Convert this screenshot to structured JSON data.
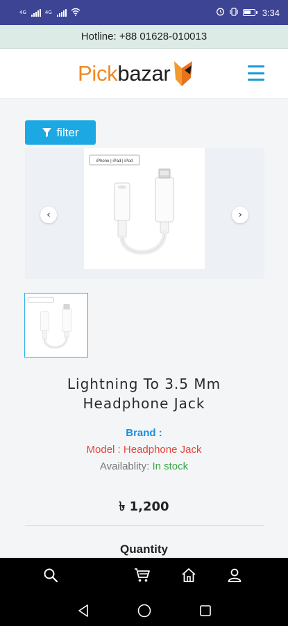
{
  "status_bar": {
    "sim1_label": "4G",
    "sim2_label": "4G",
    "time": "3:34"
  },
  "hotline": {
    "text": "Hotline: +88 01628-010013"
  },
  "header": {
    "logo_part1": "Pick",
    "logo_part2": "bazar",
    "menu_icon": "hamburger-menu-icon"
  },
  "filter": {
    "label": "filter",
    "icon": "funnel-icon"
  },
  "gallery": {
    "prev_arrow": "‹",
    "next_arrow": "›",
    "box_label": "iPhone | iPad | iPod"
  },
  "product": {
    "title": "Lightning To 3.5 Mm Headphone Jack",
    "brand_label": "Brand :",
    "brand_value": "",
    "model_text": "Model : Headphone Jack",
    "availability_label": "Availablity:",
    "availability_value": "In stock",
    "price": "৳ 1,200",
    "quantity_label": "Quantity"
  },
  "colors": {
    "status_bar": "#3e4494",
    "accent": "#1ba8e3",
    "brand_orange": "#f08a24",
    "model_red": "#e1463a",
    "stock_green": "#39a845"
  },
  "bottom_nav": {
    "items": [
      "search-icon",
      "cart-icon",
      "home-icon",
      "user-icon"
    ]
  },
  "system_nav": {
    "items": [
      "back-icon",
      "home-circle-icon",
      "recents-icon"
    ]
  }
}
